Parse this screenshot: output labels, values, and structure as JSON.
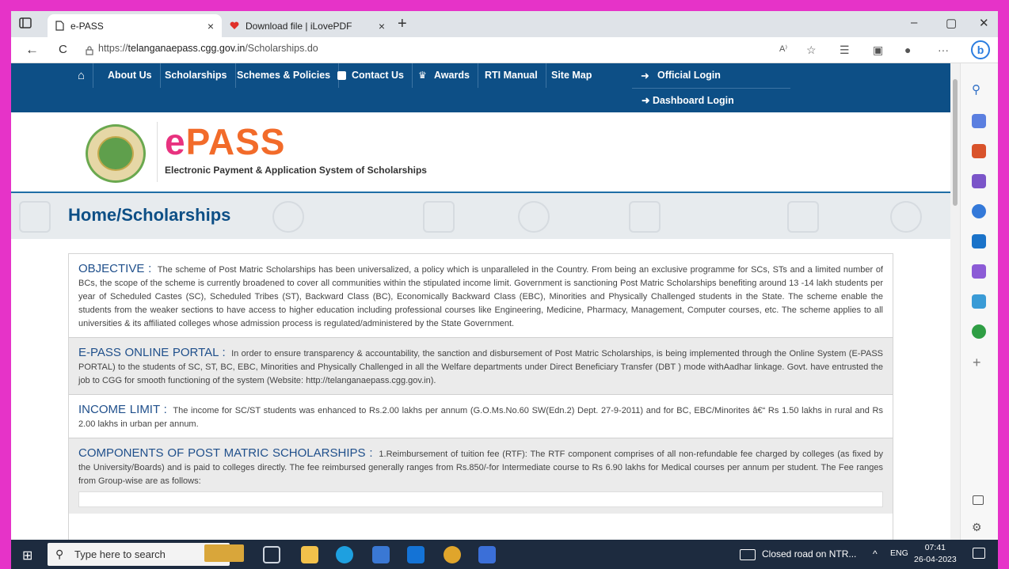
{
  "browser": {
    "tabs": [
      {
        "title": "e-PASS",
        "active": true
      },
      {
        "title": "Download file | iLovePDF",
        "active": false
      }
    ],
    "url_prefix": "https://",
    "url_host": "telanganaepass.cgg.gov.in",
    "url_path": "/Scholarships.do",
    "new_tab": "+",
    "tab_close": "×",
    "minimize": "–",
    "restore": "▢",
    "close": "✕",
    "back": "←",
    "reload": "C",
    "more": "···",
    "read_aloud": "A⁾"
  },
  "site": {
    "nav": {
      "home": "⌂",
      "items": [
        "About Us",
        "Scholarships",
        "Schemes & Policies",
        "Contact Us",
        "Awards",
        "RTI Manual",
        "Site Map"
      ],
      "official_login": "Official Login",
      "dashboard_login": "Dashboard Login"
    },
    "brand_e": "e",
    "brand_pass": "PASS",
    "brand_subtitle": "Electronic Payment & Application System of Scholarships",
    "page_title": "Home/Scholarships",
    "sections": [
      {
        "heading": "OBJECTIVE :",
        "body": "The scheme of Post Matric Scholarships has been universalized, a policy which is unparalleled in the Country. From being an exclusive programme for SCs, STs and a limited number of BCs, the scope of the scheme is currently broadened to cover all communities within the stipulated income limit. Government is sanctioning Post Matric Scholarships benefiting around 13 -14 lakh students per year of Scheduled Castes (SC), Scheduled Tribes (ST), Backward Class (BC), Economically Backward Class (EBC), Minorities and Physically Challenged students in the State. The scheme enable the students from the weaker sections to have access to higher education including professional courses like Engineering, Medicine, Pharmacy, Management, Computer courses, etc. The scheme applies to all universities & its affiliated colleges whose admission process is regulated/administered by the State Government."
      },
      {
        "heading": "E-PASS ONLINE PORTAL :",
        "body": "In order to ensure transparency & accountability, the sanction and disbursement of Post Matric Scholarships, is being implemented through the Online System (E-PASS PORTAL) to the students of SC, ST, BC, EBC, Minorities and Physically Challenged in all the Welfare departments under Direct Beneficiary Transfer (DBT ) mode withAadhar linkage. Govt. have entrusted the job to CGG for smooth functioning of the system (Website: http://telanganaepass.cgg.gov.in)."
      },
      {
        "heading": "INCOME LIMIT :",
        "body": "The income for SC/ST students was enhanced to Rs.2.00 lakhs per annum (G.O.Ms.No.60 SW(Edn.2) Dept. 27-9-2011) and for BC, EBC/Minorites â€“ Rs 1.50 lakhs in rural and Rs 2.00 lakhs in urban per annum."
      },
      {
        "heading": "COMPONENTS OF POST MATRIC SCHOLARSHIPS :",
        "body": "1.Reimbursement of tuition fee (RTF): The RTF component comprises of all non-refundable fee charged by colleges (as fixed by the University/Boards) and is paid to colleges directly. The fee reimbursed generally ranges from Rs.850/-for Intermediate course to Rs 6.90 lakhs for Medical courses per annum per student. The Fee ranges from Group-wise are as follows:"
      }
    ]
  },
  "taskbar": {
    "search_placeholder": "Type here to search",
    "news": "Closed road on NTR...",
    "lang": "ENG",
    "time": "07:41",
    "date": "26-04-2023"
  },
  "colors": {
    "frame": "#e633c8",
    "nav_bg": "#0d4f86",
    "brand_pink": "#e8327f",
    "brand_orange": "#f26b2a",
    "heading_blue": "#1f4f8b",
    "taskbar": "#1d2b3f"
  }
}
